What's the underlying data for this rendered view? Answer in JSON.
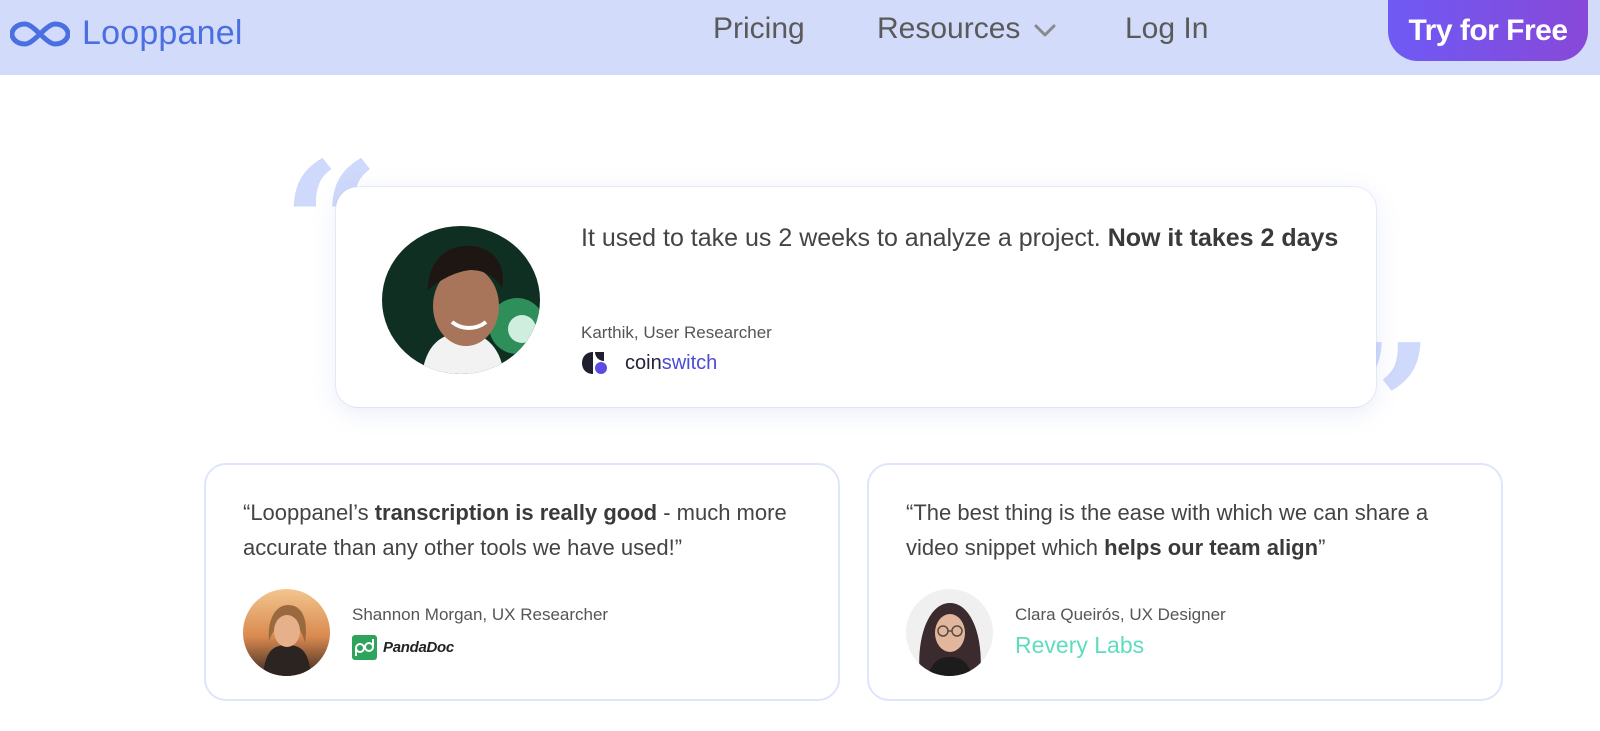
{
  "header": {
    "brand": "Looppanel",
    "nav": {
      "pricing": "Pricing",
      "resources": "Resources",
      "login": "Log In"
    },
    "cta": "Try for Free"
  },
  "featured": {
    "quote_plain": "It used to take us 2 weeks to analyze a project. ",
    "quote_bold": "Now it takes 2 days",
    "author": "Karthik, User Researcher",
    "company": {
      "part1": "coin",
      "part2": "switch"
    }
  },
  "testimonials": [
    {
      "quote_start": "“Looppanel’s ",
      "quote_bold": "transcription is really good",
      "quote_end": " - much more accurate than any other tools we have used!”",
      "author": "Shannon Morgan, UX Researcher",
      "company": "PandaDoc"
    },
    {
      "quote_start": "“The best thing is the ease with which we can share a video snippet which ",
      "quote_bold": "helps our team align",
      "quote_end": "”",
      "author": "Clara Queirós, UX Designer",
      "company": "Revery Labs"
    }
  ],
  "icons": {
    "logo": "infinity-logo-icon",
    "dropdown": "chevron-down-icon",
    "coinswitch": "coinswitch-logo-icon",
    "pandadoc": "pandadoc-logo-icon"
  },
  "colors": {
    "header_bg": "#d2dcfa",
    "brand_blue": "#4a6fe0",
    "cta_start": "#6e5af5",
    "cta_end": "#8848d8",
    "quote_mark": "#cfd9fb",
    "revery_teal": "#5fdcc0",
    "pandadoc_green": "#2ea35c"
  }
}
